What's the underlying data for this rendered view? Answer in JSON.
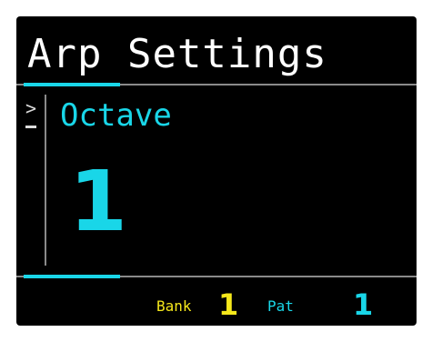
{
  "screen": {
    "title": "Arp Settings",
    "cursor": ">",
    "parameter": {
      "label": "Octave",
      "value": "1"
    },
    "footer": {
      "bank_label": "Bank",
      "bank_value": "1",
      "pattern_label": "Pat",
      "pattern_value": "1"
    }
  },
  "colors": {
    "background": "#000000",
    "title": "#ffffff",
    "accent_cyan": "#19d6e8",
    "bank_yellow": "#f5e81b",
    "divider_gray": "#8a8a8a"
  }
}
